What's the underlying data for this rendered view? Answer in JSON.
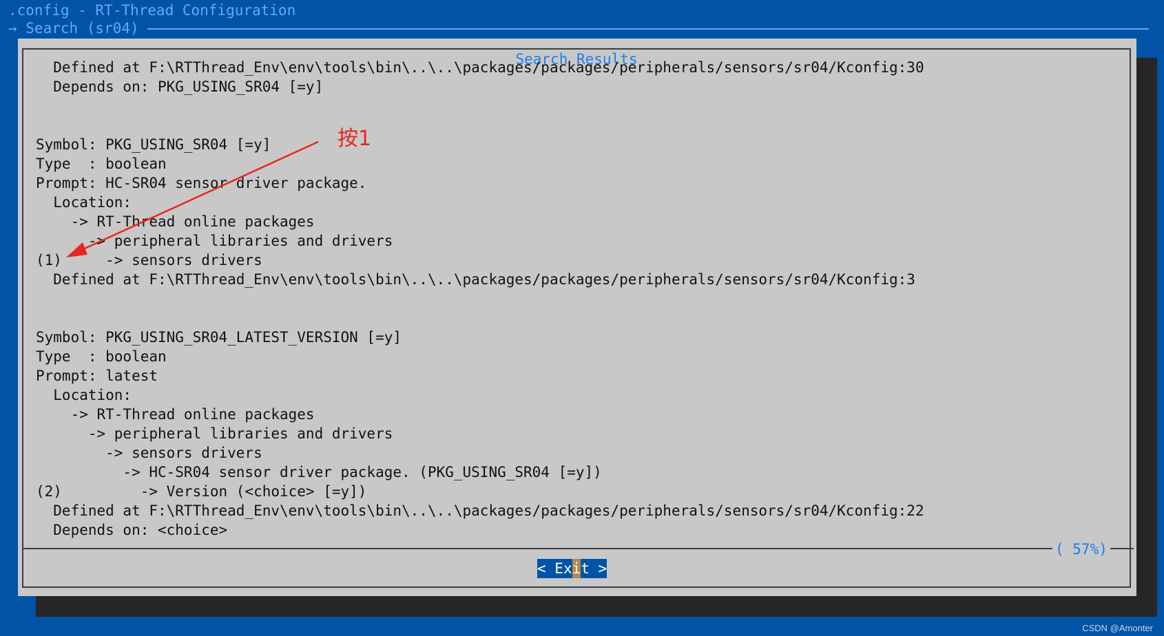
{
  "window": {
    "title": ".config - RT-Thread Configuration",
    "search_label": "→ Search (sr04)"
  },
  "dialog": {
    "title": "Search Results",
    "lines": [
      "  Defined at F:\\RTThread_Env\\env\\tools\\bin\\..\\..\\packages/packages/peripherals/sensors/sr04/Kconfig:30",
      "  Depends on: PKG_USING_SR04 [=y]",
      "",
      "",
      "Symbol: PKG_USING_SR04 [=y]",
      "Type  : boolean",
      "Prompt: HC-SR04 sensor driver package.",
      "  Location:",
      "    -> RT-Thread online packages",
      "      -> peripheral libraries and drivers",
      "(1)     -> sensors drivers",
      "  Defined at F:\\RTThread_Env\\env\\tools\\bin\\..\\..\\packages/packages/peripherals/sensors/sr04/Kconfig:3",
      "",
      "",
      "Symbol: PKG_USING_SR04_LATEST_VERSION [=y]",
      "Type  : boolean",
      "Prompt: latest",
      "  Location:",
      "    -> RT-Thread online packages",
      "      -> peripheral libraries and drivers",
      "        -> sensors drivers",
      "          -> HC-SR04 sensor driver package. (PKG_USING_SR04 [=y])",
      "(2)         -> Version (<choice> [=y])",
      "  Defined at F:\\RTThread_Env\\env\\tools\\bin\\..\\..\\packages/packages/peripherals/sensors/sr04/Kconfig:22",
      "  Depends on: <choice>"
    ],
    "scroll_percent": "( 57%)",
    "exit_button": {
      "left": "< E",
      "mid": "x",
      "hot": "i",
      "right": "t >"
    }
  },
  "annotation": {
    "text": "按1",
    "color": "#e8261f"
  },
  "watermark": "CSDN @Amonter",
  "colors": {
    "background": "#0053a6",
    "dialog": "#c8c8c8",
    "accent": "#1e7ee8",
    "button": "#0054a6",
    "hotkey": "#b5874c"
  }
}
